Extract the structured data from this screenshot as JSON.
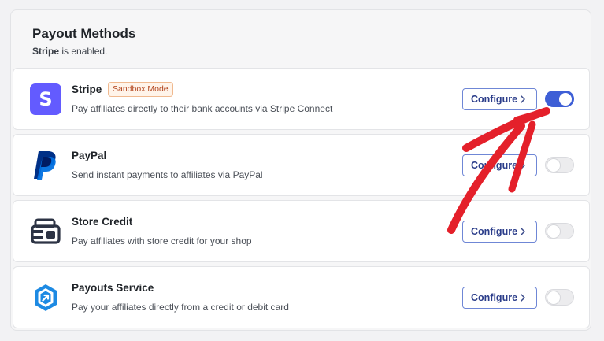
{
  "header": {
    "title": "Payout Methods",
    "subtitle_strong": "Stripe",
    "subtitle_rest": " is enabled."
  },
  "colors": {
    "accent": "#3e5fd6",
    "stripe": "#635bff",
    "annotation": "#e4202a"
  },
  "methods": [
    {
      "name": "Stripe",
      "badge": "Sandbox Mode",
      "description": "Pay affiliates directly to their bank accounts via Stripe Connect",
      "icon": "stripe-icon",
      "button": "Configure",
      "enabled": true
    },
    {
      "name": "PayPal",
      "description": "Send instant payments to affiliates via PayPal",
      "icon": "paypal-icon",
      "button": "Configure",
      "enabled": false
    },
    {
      "name": "Store Credit",
      "description": "Pay affiliates with store credit for your shop",
      "icon": "wallet-icon",
      "button": "Configure",
      "enabled": false
    },
    {
      "name": "Payouts Service",
      "description": "Pay your affiliates directly from a credit or debit card",
      "icon": "payouts-service-icon",
      "button": "Configure",
      "enabled": false
    }
  ],
  "stripe_logo_letter": "S"
}
